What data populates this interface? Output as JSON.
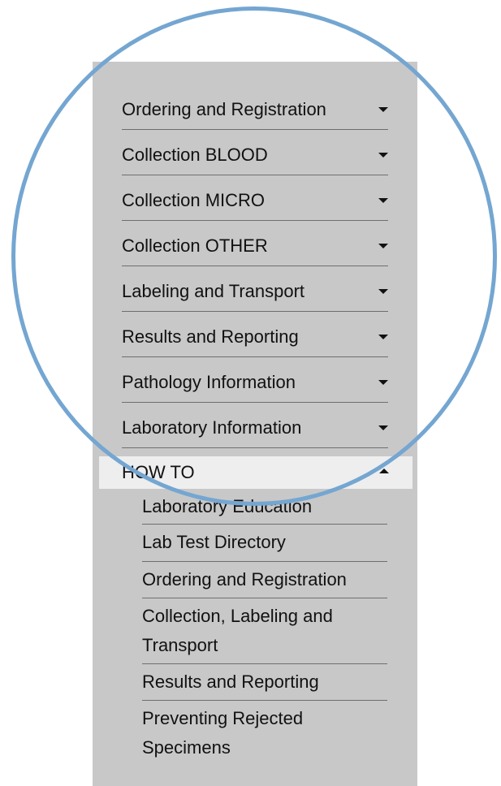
{
  "menu": {
    "items": [
      {
        "label": "Ordering and Registration"
      },
      {
        "label": "Collection BLOOD"
      },
      {
        "label": "Collection MICRO"
      },
      {
        "label": "Collection OTHER"
      },
      {
        "label": "Labeling and Transport"
      },
      {
        "label": "Results and Reporting"
      },
      {
        "label": "Pathology Information"
      },
      {
        "label": "Laboratory Information"
      }
    ],
    "expanded": {
      "label": "HOW TO",
      "subitems": [
        {
          "label": "Laboratory Education"
        },
        {
          "label": "Lab Test Directory"
        },
        {
          "label": "Ordering and Registration"
        },
        {
          "label": "Collection, Labeling and Transport"
        },
        {
          "label": "Results and Reporting"
        },
        {
          "label": "Preventing Rejected Specimens"
        }
      ]
    }
  },
  "colors": {
    "panel_bg": "#c8c8c8",
    "highlight_bg": "#eeeeee",
    "divider": "#6e6e6e",
    "circle_annotation": "#74a6d1"
  }
}
